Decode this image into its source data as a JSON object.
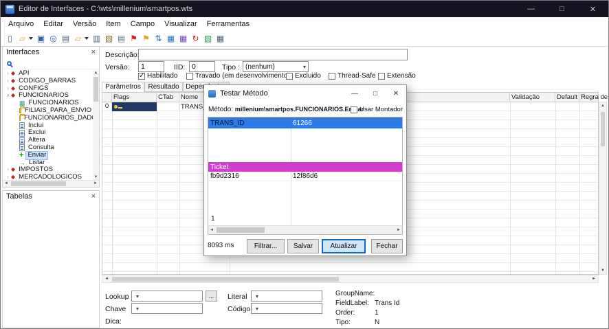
{
  "window": {
    "title": "Editor de Interfaces - C:\\wts\\millenium\\smartpos.wts",
    "controls": {
      "minimize": "—",
      "maximize": "□",
      "close": "✕"
    }
  },
  "menu": {
    "items": [
      "Arquivo",
      "Editar",
      "Versão",
      "Item",
      "Campo",
      "Visualizar",
      "Ferramentas"
    ]
  },
  "toolbar": {
    "icons": [
      {
        "name": "new-file-icon",
        "glyph": "▯",
        "color": "#556677"
      },
      {
        "name": "open-file-icon",
        "glyph": "▱",
        "color": "#d9a62e",
        "dropdown": true
      },
      {
        "name": "save-icon",
        "glyph": "▣",
        "color": "#2f5e9e"
      },
      {
        "name": "search-icon",
        "glyph": "◎",
        "color": "#2f5e9e"
      },
      {
        "name": "print-icon",
        "glyph": "▤",
        "color": "#556677"
      },
      {
        "name": "open-folder-icon",
        "glyph": "▱",
        "color": "#d9a62e",
        "dropdown": true
      },
      {
        "name": "copy-icon",
        "glyph": "▥",
        "color": "#556677"
      },
      {
        "name": "paste-icon",
        "glyph": "▧",
        "color": "#886a2a"
      },
      {
        "name": "clipboard-icon",
        "glyph": "▤",
        "color": "#667788"
      },
      {
        "name": "flag-red-icon",
        "glyph": "⚑",
        "color": "#cc2222"
      },
      {
        "name": "flag-yellow-icon",
        "glyph": "⚑",
        "color": "#e0a020"
      },
      {
        "name": "sort-arrows-icon",
        "glyph": "⇅",
        "color": "#2a7ac0"
      },
      {
        "name": "chart-icon",
        "glyph": "▦",
        "color": "#2a7ac0"
      },
      {
        "name": "chart-alt-icon",
        "glyph": "▦",
        "color": "#7a4ac0"
      },
      {
        "name": "refresh-icon",
        "glyph": "↻",
        "color": "#cc2222"
      },
      {
        "name": "export-icon",
        "glyph": "▧",
        "color": "#2a9a5a"
      },
      {
        "name": "table-icon",
        "glyph": "▦",
        "color": "#556677"
      }
    ]
  },
  "sidebar": {
    "interfaces": {
      "title": "Interfaces",
      "close_icon": "×",
      "tree": [
        {
          "label": "API",
          "icon": "interface-icon",
          "level": 0,
          "chevron": "collapsed"
        },
        {
          "label": "CODIGO_BARRAS",
          "icon": "interface-icon",
          "level": 0,
          "chevron": "collapsed"
        },
        {
          "label": "CONFIGS",
          "icon": "interface-icon",
          "level": 0,
          "chevron": "collapsed"
        },
        {
          "label": "FUNCIONARIOS",
          "icon": "interface-icon",
          "level": 0,
          "chevron": "expanded"
        },
        {
          "label": "FUNCIONARIOS",
          "icon": "grid-icon",
          "level": 1
        },
        {
          "label": "FILIAIS_PARA_ENVIO",
          "icon": "folder-icon",
          "level": 1
        },
        {
          "label": "FUNCIONARIOS_DADOS",
          "icon": "folder-icon",
          "level": 1
        },
        {
          "label": "Inclui",
          "icon": "method-icon",
          "level": 1
        },
        {
          "label": "Exclui",
          "icon": "method-icon",
          "level": 1
        },
        {
          "label": "Altera",
          "icon": "method-icon",
          "level": 1
        },
        {
          "label": "Consulta",
          "icon": "method-icon",
          "level": 1
        },
        {
          "label": "Enviar",
          "icon": "method-green-icon",
          "level": 1,
          "selected": true
        },
        {
          "label": "Listar",
          "icon": "method-green-icon",
          "level": 1
        },
        {
          "label": "IMPOSTOS",
          "icon": "interface-icon",
          "level": 0,
          "chevron": "collapsed"
        },
        {
          "label": "MERCADOLOGICOS",
          "icon": "interface-icon",
          "level": 0,
          "chevron": "collapsed"
        }
      ]
    },
    "tabelas": {
      "title": "Tabelas",
      "close_icon": "×"
    }
  },
  "form": {
    "descricao_label": "Descrição:",
    "versao_label": "Versão:",
    "versao_value": "1",
    "iid_label": "IID:",
    "iid_value": "0",
    "tipo_label": "Tipo :",
    "tipo_value": "(nenhum)",
    "checkboxes": [
      {
        "label": "Habilitado",
        "checked": true
      },
      {
        "label": "Travado (em desenvolvimento)",
        "checked": false
      },
      {
        "label": "Excluido",
        "checked": false
      },
      {
        "label": "Thread-Safe",
        "checked": false
      },
      {
        "label": "Extensão",
        "checked": false
      }
    ]
  },
  "tabs": {
    "items": [
      "Parâmetros",
      "Resultado",
      "Dependentes"
    ],
    "active": "Parâmetros"
  },
  "grid": {
    "columns": [
      "",
      "Flags",
      "CTab",
      "Nome",
      "",
      "Validação",
      "Default",
      "Regra de Visibilidade"
    ],
    "rows": [
      {
        "index": "0",
        "flags_icon": "key-icon",
        "ctab": "",
        "nome": "TRANS_ID"
      }
    ]
  },
  "dialog": {
    "title": "Testar Método",
    "controls": {
      "minimize": "—",
      "maximize": "□",
      "close": "✕"
    },
    "metodo_label": "Método:",
    "metodo_value": "millenium\\smartpos.FUNCIONARIOS.Enviar",
    "usar_montador_label": "Usar Montador",
    "grid": {
      "selected_row": {
        "name": "TRANS_ID",
        "value": "61266"
      },
      "ticket_header": "Ticket",
      "ticket_row": {
        "col1": "fb9d2316",
        "col2": "12f86d6"
      },
      "row_count": "1"
    },
    "status": "8093 ms",
    "buttons": [
      "Filtrar...",
      "Salvar",
      "Atualizar",
      "Fechar"
    ],
    "default_button": "Atualizar"
  },
  "bottom": {
    "lookup_label": "Lookup",
    "literal_label": "Literal",
    "chave_label": "Chave",
    "codigo_label": "Código",
    "dica_label": "Dica:",
    "more_button": "...",
    "right": {
      "groupname_label": "GroupName:",
      "fieldlabel_label": "FieldLabel:",
      "fieldlabel_value": "Trans Id",
      "order_label": "Order:",
      "order_value": "1",
      "tipo_label": "Tipo:",
      "tipo_value": "N"
    }
  },
  "colors": {
    "titlebar": "#141420",
    "selection": "#2d7ce5",
    "ticket": "#cf3ecf",
    "accent": "#0d6bc4",
    "flags_cell": "#1f3864"
  }
}
